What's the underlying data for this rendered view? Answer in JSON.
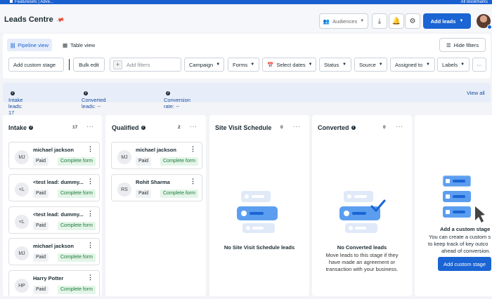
{
  "bookmarks": {
    "left_text": "Featuresets | Adve...",
    "right_text": "All Bookmarks"
  },
  "header": {
    "title": "Leads Centre",
    "audiences_label": "Audiences",
    "add_leads_label": "Add leads"
  },
  "views": {
    "pipeline_label": "Pipeline view",
    "table_label": "Table view",
    "hide_filters_label": "Hide filters"
  },
  "toolbar": {
    "add_custom_stage": "Add custom stage",
    "bulk_edit": "Bulk edit",
    "add_filters_placeholder": "Add filters",
    "filters": [
      "Campaign",
      "Forms",
      "Select dates",
      "Status",
      "Source",
      "Assigned to",
      "Labels"
    ],
    "more": "···"
  },
  "stats": {
    "intake_label": "Intake leads: 17",
    "converted_label": "Converted leads: --",
    "rate_label": "Conversion rate: --",
    "view_all": "View all"
  },
  "columns": {
    "intake": {
      "title": "Intake",
      "count": "17",
      "cards": [
        {
          "initials": "MJ",
          "name": "michael jackson",
          "tag": "Paid",
          "status": "Complete form"
        },
        {
          "initials": "<L",
          "name": "<test lead: dummy...",
          "tag": "Paid",
          "status": "Complete form"
        },
        {
          "initials": "<L",
          "name": "<test lead: dummy...",
          "tag": "Paid",
          "status": "Complete form"
        },
        {
          "initials": "MJ",
          "name": "michael jackson",
          "tag": "Paid",
          "status": "Complete form"
        },
        {
          "initials": "HP",
          "name": "Harry Potter",
          "tag": "Paid",
          "status": "Complete form"
        }
      ]
    },
    "qualified": {
      "title": "Qualified",
      "count": "2",
      "cards": [
        {
          "initials": "MJ",
          "name": "michael jackson",
          "tag": "Paid",
          "status": "Complete form"
        },
        {
          "initials": "RS",
          "name": "Rohit Sharma",
          "tag": "Paid",
          "status": "Complete form"
        }
      ]
    },
    "site_visit": {
      "title": "Site Visit Schedule",
      "count": "0",
      "empty_title": "No Site Visit Schedule leads"
    },
    "converted": {
      "title": "Converted",
      "count": "0",
      "empty_title": "No Converted leads",
      "empty_desc": [
        "Move leads to this stage if they",
        "have made an agreement or",
        "transaction with your business."
      ]
    },
    "custom": {
      "title": "Add a custom stage",
      "desc": [
        "You can create a custom s",
        "to keep track of key outco",
        "ahead of conversion."
      ],
      "button": "Add custom stage"
    }
  },
  "colors": {
    "primary": "#1a64d4",
    "complete_bg": "#e3f5e8",
    "complete_text": "#1e7a3a"
  }
}
